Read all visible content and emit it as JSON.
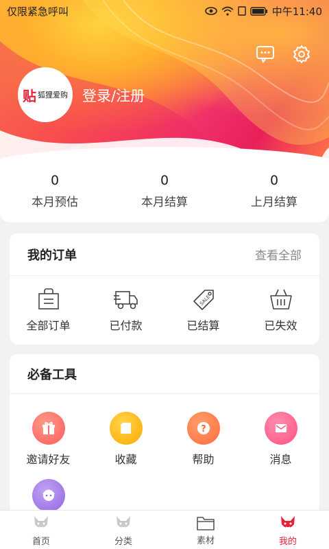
{
  "status_bar": {
    "carrier": "仅限紧急呼叫",
    "time": "中午11:40"
  },
  "header": {
    "avatar_logo_text": "狐狸爱购",
    "login_label": "登录/注册",
    "icons": [
      "message-icon",
      "gear-icon"
    ]
  },
  "stats": [
    {
      "value": "0",
      "label": "本月预估"
    },
    {
      "value": "0",
      "label": "本月结算"
    },
    {
      "value": "0",
      "label": "上月结算"
    }
  ],
  "orders": {
    "title": "我的订单",
    "view_all": "查看全部",
    "items": [
      {
        "label": "全部订单",
        "icon": "bag-icon"
      },
      {
        "label": "已付款",
        "icon": "truck-icon"
      },
      {
        "label": "已结算",
        "icon": "sale-tag-icon"
      },
      {
        "label": "已失效",
        "icon": "basket-icon"
      }
    ]
  },
  "tools": {
    "title": "必备工具",
    "items": [
      {
        "label": "邀请好友",
        "icon": "gift-icon",
        "color": "#ff6b6b"
      },
      {
        "label": "收藏",
        "icon": "book-icon",
        "color": "#ffb300"
      },
      {
        "label": "帮助",
        "icon": "question-icon",
        "color": "#ff7043"
      },
      {
        "label": "消息",
        "icon": "mail-icon",
        "color": "#ff5c8a"
      }
    ],
    "extra_icon": "service-avatar-icon",
    "extra_color": "#a47be8"
  },
  "tabbar": {
    "items": [
      {
        "label": "首页",
        "icon": "fox-home-icon"
      },
      {
        "label": "分类",
        "icon": "fox-category-icon"
      },
      {
        "label": "素材",
        "icon": "folder-icon"
      },
      {
        "label": "我的",
        "icon": "fox-mine-icon"
      }
    ],
    "active_index": 3,
    "accent": "#e8203a"
  }
}
